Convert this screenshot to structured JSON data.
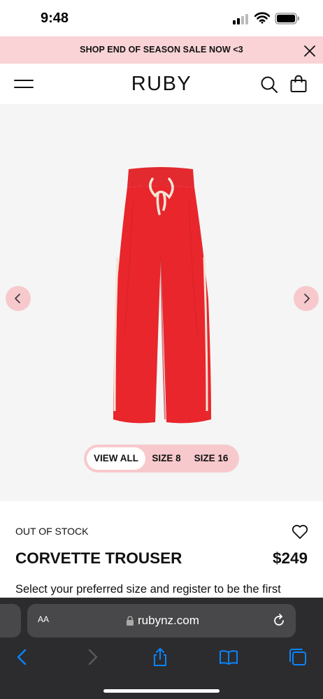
{
  "status_bar": {
    "time": "9:48"
  },
  "promo": {
    "text": "SHOP END OF SEASON SALE NOW <3"
  },
  "header": {
    "brand": "RUBY"
  },
  "gallery": {
    "size_filters": [
      "VIEW ALL",
      "SIZE 8",
      "SIZE 16"
    ],
    "selected_filter": "VIEW ALL"
  },
  "product": {
    "stock_status": "OUT OF STOCK",
    "name": "CORVETTE TROUSER",
    "price": "$249",
    "description": "Select your preferred size and register to be the first"
  },
  "browser": {
    "text_size_label": "AA",
    "url": "rubynz.com"
  },
  "colors": {
    "promo_bg": "#f9d3d6",
    "accent_pink": "#f7c9cd",
    "product_red": "#e8262c",
    "browser_bg": "#2c2c2e",
    "ios_blue": "#0a84ff"
  },
  "icons": [
    "signal-icon",
    "wifi-icon",
    "battery-icon",
    "close-icon",
    "hamburger-menu-icon",
    "search-icon",
    "shopping-bag-icon",
    "chevron-left-icon",
    "chevron-right-icon",
    "heart-icon",
    "lock-icon",
    "reload-icon",
    "share-icon",
    "book-icon",
    "tabs-icon"
  ]
}
